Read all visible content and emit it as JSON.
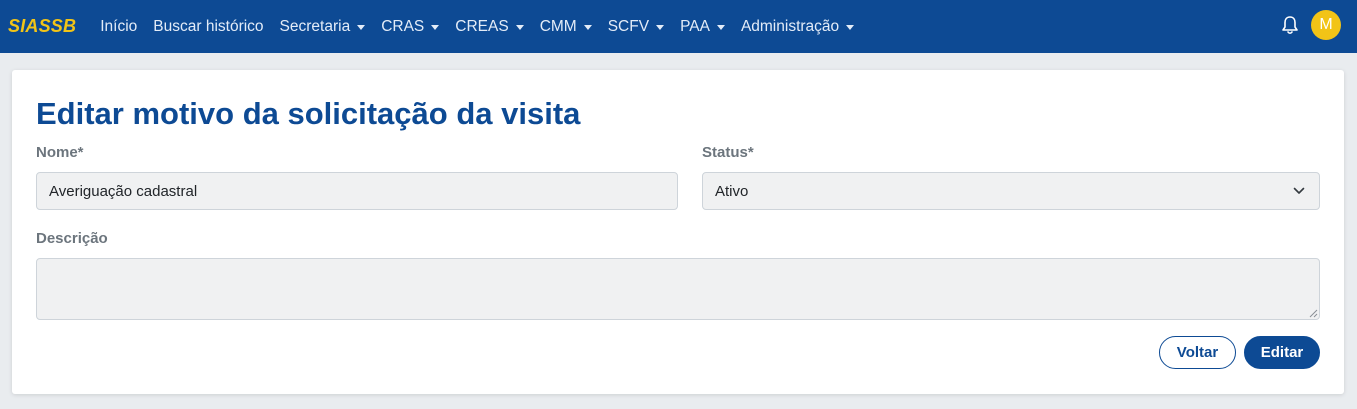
{
  "app": {
    "brand": "SIASSB"
  },
  "nav": {
    "items": [
      {
        "label": "Início",
        "has_dropdown": false
      },
      {
        "label": "Buscar histórico",
        "has_dropdown": false
      },
      {
        "label": "Secretaria",
        "has_dropdown": true
      },
      {
        "label": "CRAS",
        "has_dropdown": true
      },
      {
        "label": "CREAS",
        "has_dropdown": true
      },
      {
        "label": "CMM",
        "has_dropdown": true
      },
      {
        "label": "SCFV",
        "has_dropdown": true
      },
      {
        "label": "PAA",
        "has_dropdown": true
      },
      {
        "label": "Administração",
        "has_dropdown": true
      }
    ],
    "notifications_icon": "bell-icon",
    "avatar_initial": "M"
  },
  "form": {
    "title": "Editar motivo da solicitação da visita",
    "nome_label": "Nome*",
    "nome_value": "Averiguação cadastral",
    "status_label": "Status*",
    "status_value": "Ativo",
    "descricao_label": "Descrição",
    "descricao_value": "",
    "back_label": "Voltar",
    "submit_label": "Editar"
  },
  "colors": {
    "navbar": "#0d4a94",
    "brand": "#f2c417",
    "accent": "#0d4a94",
    "avatar": "#f2c417",
    "page_background": "#e9ecef"
  }
}
